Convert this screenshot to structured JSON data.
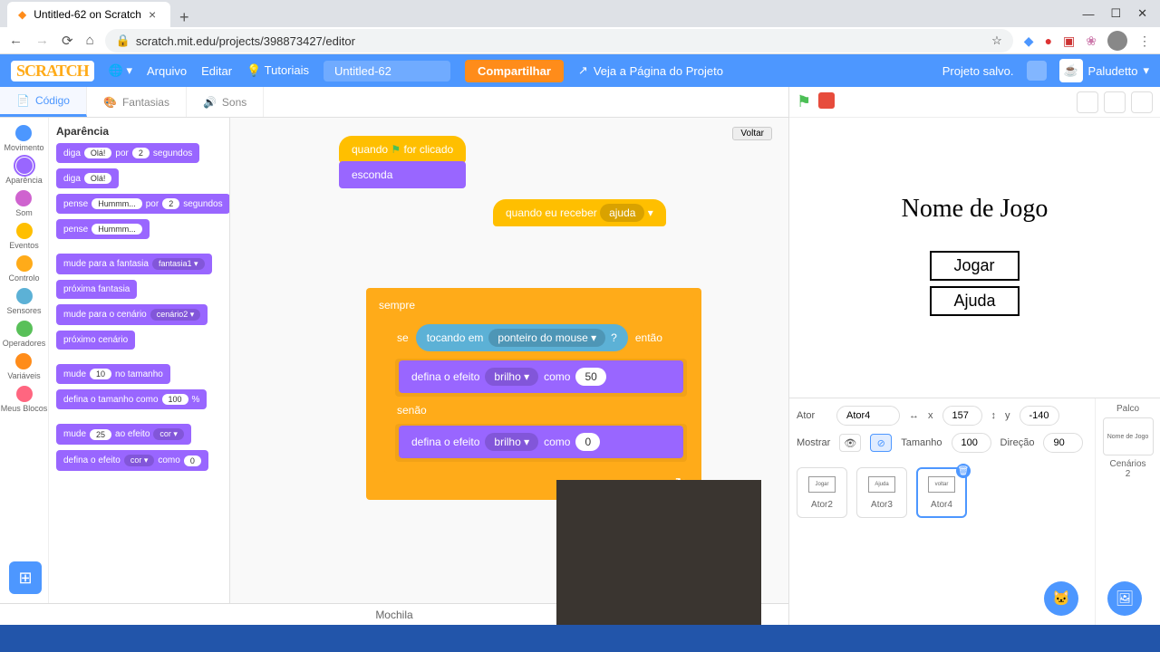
{
  "browser": {
    "tab_title": "Untitled-62 on Scratch",
    "url": "scratch.mit.edu/projects/398873427/editor"
  },
  "menu": {
    "logo": "SCRATCH",
    "file": "Arquivo",
    "edit": "Editar",
    "tutorials": "Tutoriais",
    "project_title": "Untitled-62",
    "share": "Compartilhar",
    "see_project": "Veja a Página do Projeto",
    "save_status": "Projeto salvo.",
    "username": "Paludetto"
  },
  "tabs": {
    "code": "Código",
    "costumes": "Fantasias",
    "sounds": "Sons"
  },
  "categories": [
    {
      "name": "Movimento",
      "color": "#4c97ff"
    },
    {
      "name": "Aparência",
      "color": "#9966ff"
    },
    {
      "name": "Som",
      "color": "#cf63cf"
    },
    {
      "name": "Eventos",
      "color": "#ffbf00"
    },
    {
      "name": "Controlo",
      "color": "#ffab19"
    },
    {
      "name": "Sensores",
      "color": "#5cb1d6"
    },
    {
      "name": "Operadores",
      "color": "#59c059"
    },
    {
      "name": "Variáveis",
      "color": "#ff8c1a"
    },
    {
      "name": "Meus Blocos",
      "color": "#ff6680"
    }
  ],
  "palette": {
    "title": "Aparência",
    "blocks": {
      "say_for": {
        "t1": "diga",
        "v1": "Olá!",
        "t2": "por",
        "v2": "2",
        "t3": "segundos"
      },
      "say": {
        "t1": "diga",
        "v1": "Olá!"
      },
      "think_for": {
        "t1": "pense",
        "v1": "Hummm...",
        "t2": "por",
        "v2": "2",
        "t3": "segundos"
      },
      "think": {
        "t1": "pense",
        "v1": "Hummm..."
      },
      "switch_costume": {
        "t1": "mude para a fantasia",
        "v1": "fantasia1"
      },
      "next_costume": {
        "t1": "próxima fantasia"
      },
      "switch_backdrop": {
        "t1": "mude para o cenário",
        "v1": "cenário2"
      },
      "next_backdrop": {
        "t1": "próximo cenário"
      },
      "change_size": {
        "t1": "mude",
        "v1": "10",
        "t2": "no tamanho"
      },
      "set_size": {
        "t1": "defina o tamanho como",
        "v1": "100",
        "t2": "%"
      },
      "change_effect": {
        "t1": "mude",
        "v1": "25",
        "t2": "ao efeito",
        "v2": "cor"
      },
      "set_effect": {
        "t1": "defina o efeito",
        "v1": "cor",
        "t2": "como",
        "v2": "0"
      }
    }
  },
  "canvas": {
    "go_back": "Voltar",
    "hat1": {
      "t1": "quando",
      "t2": "for clicado"
    },
    "hide": "esconda",
    "hat2": {
      "t1": "quando eu receber",
      "v1": "ajuda"
    },
    "forever": "sempre",
    "if": "se",
    "then": "então",
    "else": "senão",
    "touching": {
      "t1": "tocando em",
      "v1": "ponteiro do mouse",
      "q": "?"
    },
    "set_effect1": {
      "t1": "defina o efeito",
      "v1": "brilho",
      "t2": "como",
      "v2": "50"
    },
    "set_effect2": {
      "t1": "defina o efeito",
      "v1": "brilho",
      "t2": "como",
      "v2": "0"
    }
  },
  "backpack": "Mochila",
  "stage": {
    "title": "Nome de Jogo",
    "play": "Jogar",
    "help": "Ajuda"
  },
  "sprite_info": {
    "sprite_label": "Ator",
    "sprite_name": "Ator4",
    "x_label": "x",
    "x": "157",
    "y_label": "y",
    "y": "-140",
    "show_label": "Mostrar",
    "size_label": "Tamanho",
    "size": "100",
    "direction_label": "Direção",
    "direction": "90"
  },
  "sprites": [
    {
      "name": "Ator2",
      "thumb": "Jogar"
    },
    {
      "name": "Ator3",
      "thumb": "Ajuda"
    },
    {
      "name": "Ator4",
      "thumb": "voltar"
    }
  ],
  "stage_panel": {
    "label": "Palco",
    "thumb": "Nome de Jogo",
    "backdrops_label": "Cenários",
    "backdrops_count": "2"
  }
}
